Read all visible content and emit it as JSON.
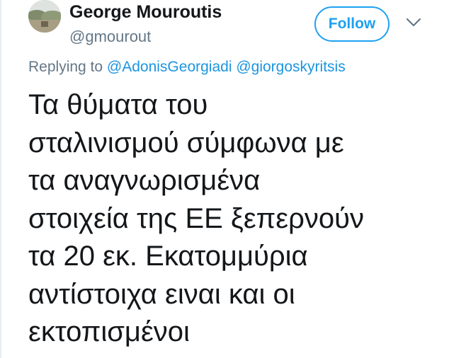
{
  "tweet": {
    "author": {
      "display_name": "George Mouroutis",
      "handle": "@gmourout"
    },
    "follow_label": "Follow",
    "menu_icon": "chevron-down-icon",
    "reply_context": {
      "prefix": "Replying to",
      "mentions": [
        "@AdonisGeorgiadi",
        "@giorgoskyritsis"
      ]
    },
    "text": "Τα θύματα του\nσταλινισμού σύμφωνα με\nτα αναγνωρισμένα\nστοιχεία της ΕΕ ξεπερνούν\nτα 20 εκ. Εκατομμύρια\nαντίστοιχα ειναι και οι\nεκτοπισμένοι"
  },
  "colors": {
    "accent": "#1da1f2",
    "mention": "#1b95e0",
    "secondary_text": "#657786",
    "primary_text": "#14171a"
  }
}
